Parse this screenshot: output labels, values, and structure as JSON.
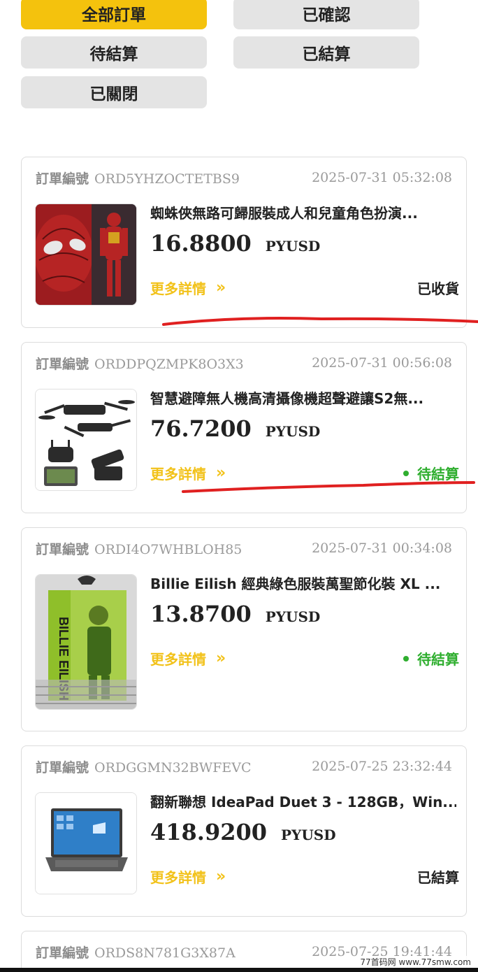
{
  "filters": [
    {
      "label": "全部訂單",
      "active": true
    },
    {
      "label": "已確認",
      "active": false
    },
    {
      "label": "待結算",
      "active": false
    },
    {
      "label": "已結算",
      "active": false
    },
    {
      "label": "已關閉",
      "active": false
    }
  ],
  "order_label": "訂單編號",
  "more_label": "更多詳情",
  "more_icon": "double-chevron-right-icon",
  "orders": [
    {
      "order_no": "ORD5YHZOCTETBS9",
      "time": "2025-07-31 05:32:08",
      "title": "蜘蛛俠無路可歸服裝成人和兒童角色扮演...",
      "price": "16.8800",
      "currency": "PYUSD",
      "status": "已收貨",
      "status_type": "done",
      "thumb_icon": "spiderman-costume-image"
    },
    {
      "order_no": "ORDDPQZMPK8O3X3",
      "time": "2025-07-31 00:56:08",
      "title": "智慧避障無人機高清攝像機超聲避讓S2無...",
      "price": "76.7200",
      "currency": "PYUSD",
      "status": "待結算",
      "status_type": "pending",
      "thumb_icon": "drone-image"
    },
    {
      "order_no": "ORDI4O7WHBLOH85",
      "time": "2025-07-31 00:34:08",
      "title": "Billie Eilish 經典綠色服裝萬聖節化裝 XL ...",
      "price": "13.8700",
      "currency": "PYUSD",
      "status": "待結算",
      "status_type": "pending",
      "thumb_icon": "green-costume-image"
    },
    {
      "order_no": "ORDGGMN32BWFEVC",
      "time": "2025-07-25 23:32:44",
      "title": "翻新聯想 IdeaPad Duet 3 - 128GB，Win...",
      "price": "418.9200",
      "currency": "PYUSD",
      "status": "已結算",
      "status_type": "done",
      "thumb_icon": "laptop-image"
    },
    {
      "order_no": "ORDS8N781G3X87A",
      "time": "2025-07-25 19:41:44"
    }
  ],
  "watermark": "77首码网 www.77smw.com",
  "colors": {
    "accent": "#f4c20d",
    "pending": "#2fae2f",
    "annotation": "#e02020"
  }
}
